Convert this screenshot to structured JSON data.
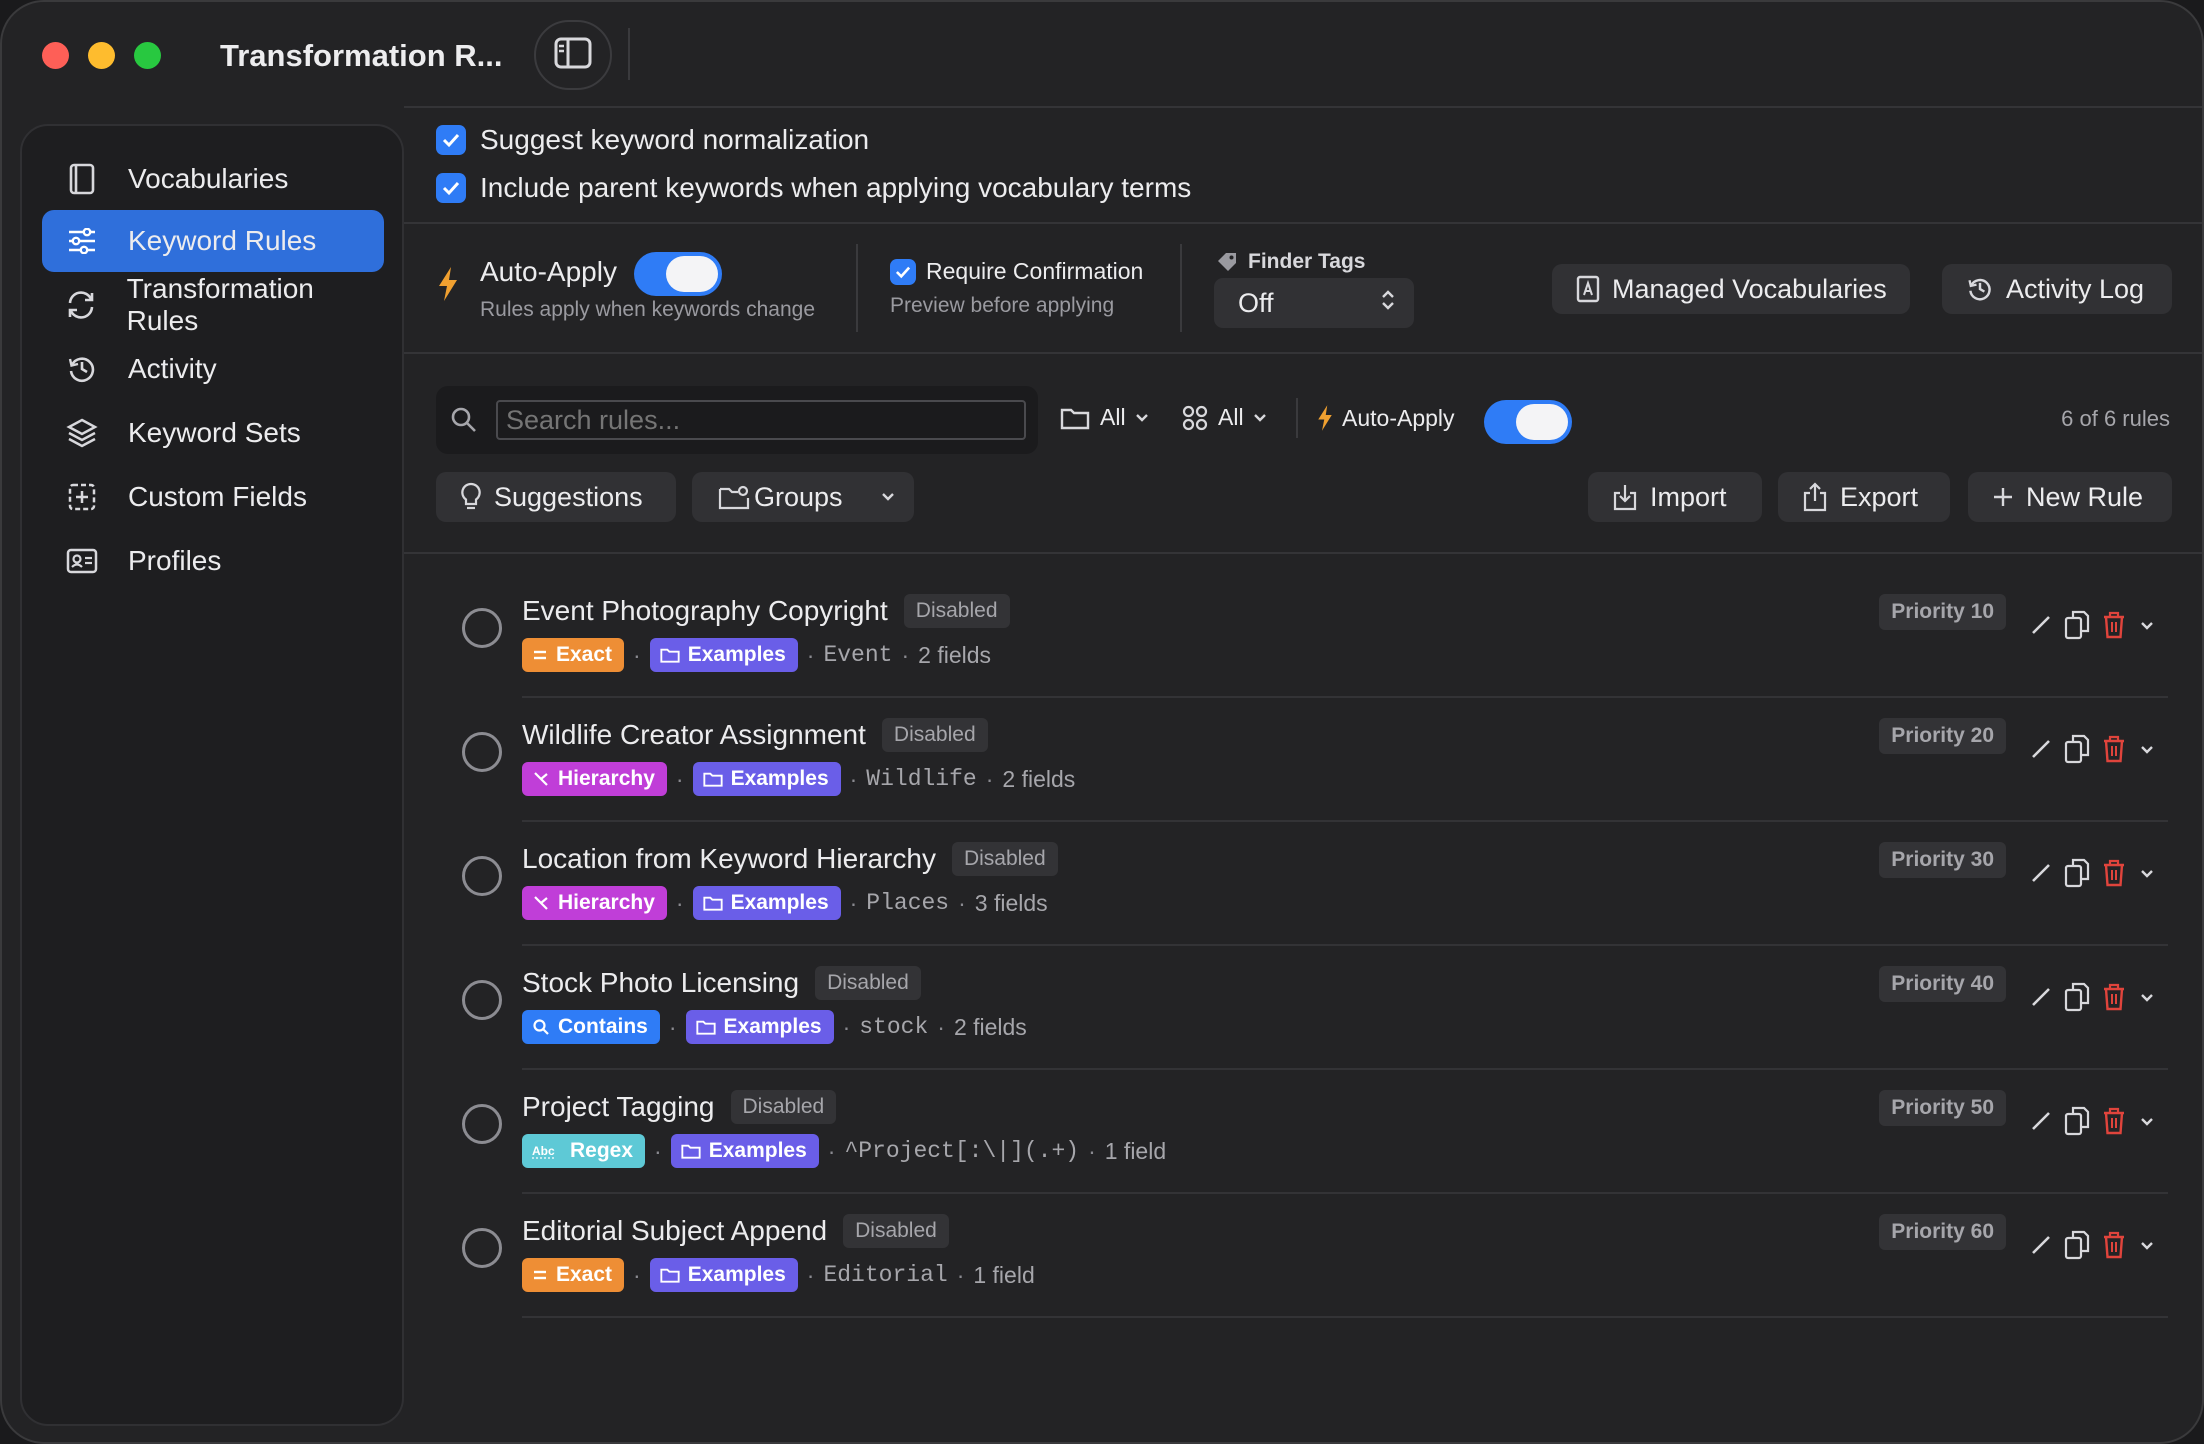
{
  "window": {
    "title": "Transformation R..."
  },
  "sidebar": {
    "items": [
      {
        "label": "Vocabularies",
        "icon": "book-icon"
      },
      {
        "label": "Keyword Rules",
        "icon": "sliders-icon",
        "active": true
      },
      {
        "label": "Transformation Rules",
        "icon": "refresh-icon"
      },
      {
        "label": "Activity",
        "icon": "history-icon"
      },
      {
        "label": "Keyword Sets",
        "icon": "layers-icon"
      },
      {
        "label": "Custom Fields",
        "icon": "plus-square-icon"
      },
      {
        "label": "Profiles",
        "icon": "id-card-icon"
      }
    ]
  },
  "options": {
    "suggest_normalization": "Suggest keyword normalization",
    "include_parent": "Include parent keywords when applying vocabulary terms"
  },
  "settings": {
    "auto_apply_label": "Auto-Apply",
    "auto_apply_sub": "Rules apply when keywords change",
    "require_confirm_label": "Require Confirmation",
    "require_confirm_sub": "Preview before applying",
    "finder_tags_label": "Finder Tags",
    "finder_tags_value": "Off",
    "managed_vocab_button": "Managed Vocabularies",
    "activity_log_button": "Activity Log"
  },
  "toolbar": {
    "search_placeholder": "Search rules...",
    "filter_folder": "All",
    "filter_type": "All",
    "auto_apply_label": "Auto-Apply",
    "count": "6 of 6 rules",
    "suggestions_button": "Suggestions",
    "groups_button": "Groups",
    "import_button": "Import",
    "export_button": "Export",
    "new_rule_button": "New Rule"
  },
  "colors": {
    "accent": "#2f7cf6",
    "sidebar_active": "#2f6fdb",
    "exact": "#ee8e35",
    "hierarchy": "#c03ed8",
    "contains": "#2f7cf6",
    "regex": "#5ec9d6",
    "group": "#6a5ee8",
    "delete": "#e0443c"
  },
  "rules": [
    {
      "name": "Event Photography Copyright",
      "status": "Disabled",
      "match": "Exact",
      "match_kind": "exact",
      "group": "Examples",
      "pattern": "Event",
      "fields": "2 fields",
      "priority": "Priority 10"
    },
    {
      "name": "Wildlife Creator Assignment",
      "status": "Disabled",
      "match": "Hierarchy",
      "match_kind": "hierarchy",
      "group": "Examples",
      "pattern": "Wildlife",
      "fields": "2 fields",
      "priority": "Priority 20"
    },
    {
      "name": "Location from Keyword Hierarchy",
      "status": "Disabled",
      "match": "Hierarchy",
      "match_kind": "hierarchy",
      "group": "Examples",
      "pattern": "Places",
      "fields": "3 fields",
      "priority": "Priority 30"
    },
    {
      "name": "Stock Photo Licensing",
      "status": "Disabled",
      "match": "Contains",
      "match_kind": "contains",
      "group": "Examples",
      "pattern": "stock",
      "fields": "2 fields",
      "priority": "Priority 40"
    },
    {
      "name": "Project Tagging",
      "status": "Disabled",
      "match": "Regex",
      "match_kind": "regex",
      "group": "Examples",
      "pattern": "^Project[:\\|](.+)",
      "fields": "1 field",
      "priority": "Priority 50"
    },
    {
      "name": "Editorial Subject Append",
      "status": "Disabled",
      "match": "Exact",
      "match_kind": "exact",
      "group": "Examples",
      "pattern": "Editorial",
      "fields": "1 field",
      "priority": "Priority 60"
    }
  ]
}
